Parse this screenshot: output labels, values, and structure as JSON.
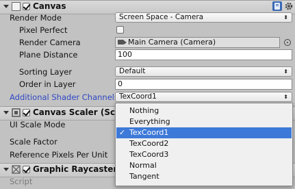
{
  "canvas": {
    "title": "Canvas",
    "render_mode_label": "Render Mode",
    "render_mode_value": "Screen Space - Camera",
    "pixel_perfect_label": "Pixel Perfect",
    "render_camera_label": "Render Camera",
    "render_camera_value": "Main Camera (Camera)",
    "plane_distance_label": "Plane Distance",
    "plane_distance_value": "100",
    "sorting_layer_label": "Sorting Layer",
    "sorting_layer_value": "Default",
    "order_in_layer_label": "Order in Layer",
    "order_in_layer_value": "0",
    "additional_shader_label": "Additional Shader Channels",
    "additional_shader_value": "TexCoord1"
  },
  "canvas_scaler": {
    "title": "Canvas Scaler (Script)",
    "ui_scale_mode_label": "UI Scale Mode",
    "scale_factor_label": "Scale Factor",
    "reference_ppu_label": "Reference Pixels Per Unit"
  },
  "graphic_raycaster": {
    "title": "Graphic Raycaster (Sc",
    "script_label": "Script"
  },
  "dropdown": {
    "options": [
      "Nothing",
      "Everything",
      "TexCoord1",
      "TexCoord2",
      "TexCoord3",
      "Normal",
      "Tangent"
    ],
    "selected": "TexCoord1",
    "check": "✓"
  },
  "colors": {
    "highlight_label": "#2f48c4",
    "selection": "#3d79d8"
  },
  "icons": [
    "canvas-component-icon",
    "book-help-icon",
    "gear-icon",
    "canvas-scaler-icon",
    "graphic-raycaster-icon",
    "camera-icon",
    "object-picker-icon",
    "dropdown-arrow-icon",
    "checkmark-icon"
  ]
}
